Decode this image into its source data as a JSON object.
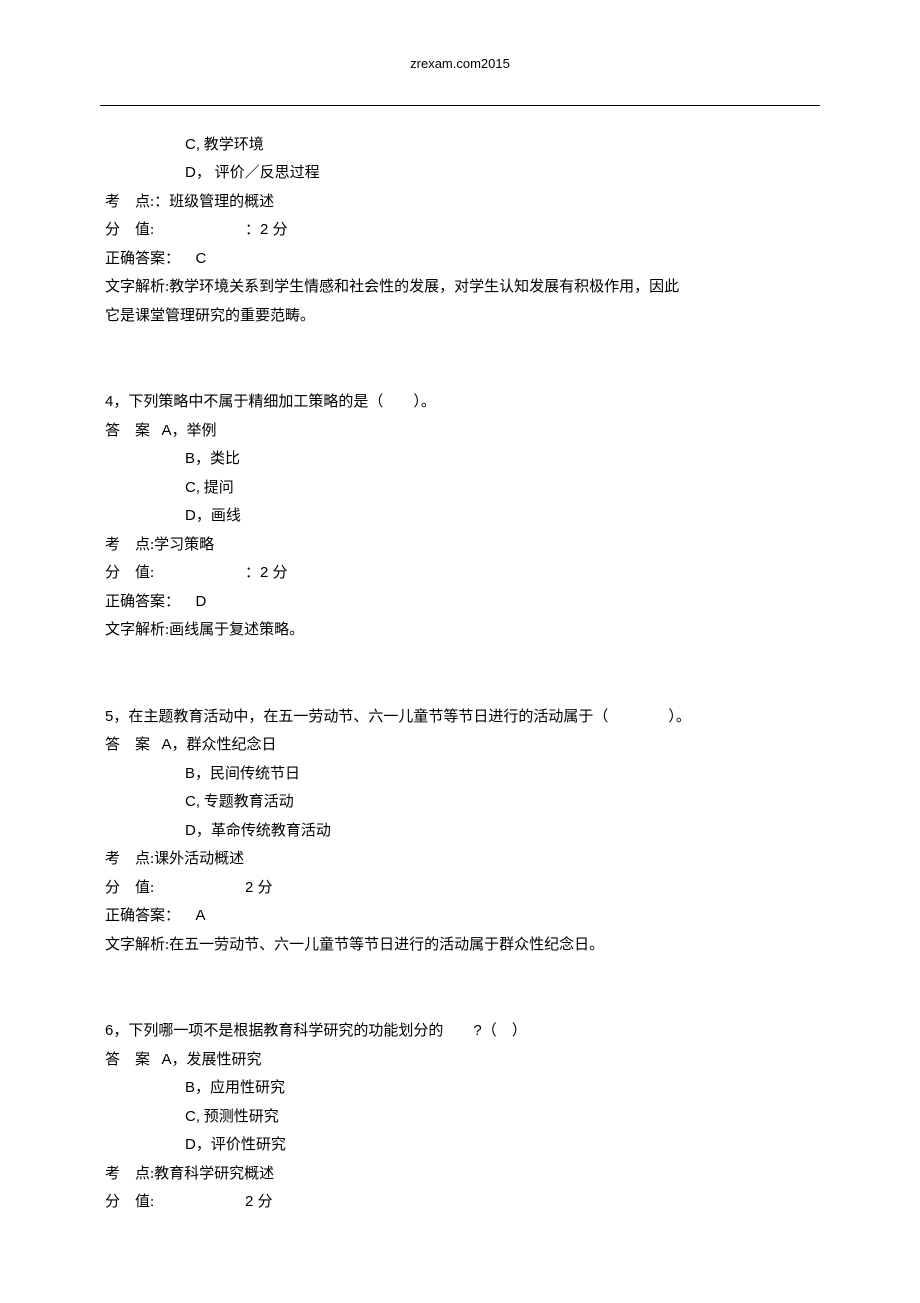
{
  "header": "zrexam.com2015",
  "q3": {
    "optC_letter": "C,",
    "optC": "教学环境",
    "optD_letter": "D，",
    "optD": "评价／反思过程",
    "kd_label": "考　点:",
    "kd": "：班级管理的概述",
    "fz_label": "分　值:",
    "fz": "：2 分",
    "ans_label": "正确答案：",
    "ans": "C",
    "jx_label": "文字解析:",
    "jx1": "教学环境关系到学生情感和社会性的发展，对学生认知发展有积极作用，因此",
    "jx2": "它是课堂管理研究的重要范畴。"
  },
  "q4": {
    "num": "4，",
    "stem": "下列策略中不属于精细加工策略的是（　　）。",
    "da_label": "答　案",
    "optA_letter": "A，",
    "optA": "举例",
    "optB_letter": "B，",
    "optB": "类比",
    "optC_letter": "C,",
    "optC": "提问",
    "optD_letter": "D，",
    "optD": "画线",
    "kd_label": "考　点:",
    "kd": "学习策略",
    "fz_label": "分　值:",
    "fz": "：2 分",
    "ans_label": "正确答案：",
    "ans": "D",
    "jx_label": "文字解析:",
    "jx": "画线属于复述策略。"
  },
  "q5": {
    "num": "5，",
    "stem": "在主题教育活动中，在五一劳动节、六一儿童节等节日进行的活动属于（　　　　）。",
    "da_label": "答　案",
    "optA_letter": "A，",
    "optA": "群众性纪念日",
    "optB_letter": "B，",
    "optB": "民间传统节日",
    "optC_letter": "C,",
    "optC": "专题教育活动",
    "optD_letter": "D，",
    "optD": "革命传统教育活动",
    "kd_label": "考　点:",
    "kd": "课外活动概述",
    "fz_label": "分　值:",
    "fz": "2 分",
    "ans_label": "正确答案：",
    "ans": "A",
    "jx_label": "文字解析:",
    "jx": "在五一劳动节、六一儿童节等节日进行的活动属于群众性纪念日。"
  },
  "q6": {
    "num": "6，",
    "stem1": "下列哪一项不是根据教育科学研究的功能划分的",
    "stem2": "?（　）",
    "da_label": "答　案",
    "optA_letter": "A，",
    "optA": "发展性研究",
    "optB_letter": "B，",
    "optB": "应用性研究",
    "optC_letter": "C,",
    "optC": "预测性研究",
    "optD_letter": "D，",
    "optD": "评价性研究",
    "kd_label": "考　点:",
    "kd": "教育科学研究概述",
    "fz_label": "分　值:",
    "fz": "2 分"
  }
}
